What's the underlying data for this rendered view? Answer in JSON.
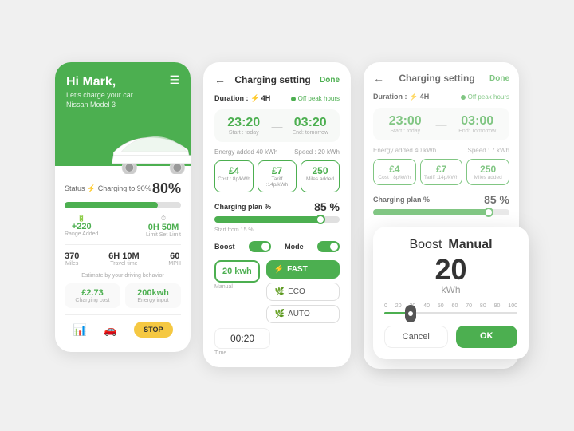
{
  "colors": {
    "green": "#4caf50",
    "yellow": "#f5c842",
    "light_bg": "#f0f0f0",
    "white": "#ffffff"
  },
  "left_card": {
    "greeting": "Hi Mark,",
    "subtext": "Let's charge your car",
    "model": "Nissan Model 3",
    "status_label": "Status ⚡ Charging to 90%",
    "status_value": "80%",
    "progress_pct": 80,
    "range_added": "+220",
    "range_label": "Range Added",
    "limit_val": "0H 50M",
    "limit_label": "Limit Set Limit",
    "miles": "370",
    "miles_label": "Miles",
    "travel": "6H 10M",
    "travel_label": "Travel time",
    "speed": "60",
    "speed_label": "MPH",
    "estimate_text": "Estimate by your driving behavior",
    "charge_cost": "£2.73",
    "charge_cost_label": "Charging cost",
    "energy_input": "200kwh",
    "energy_input_label": "Energy input",
    "stop_label": "STOP"
  },
  "mid_card": {
    "title": "Charging setting",
    "done_label": "Done",
    "duration_label": "Duration : ⚡ 4H",
    "off_peak_label": "Off peak hours",
    "start_time": "23:20",
    "start_time_label": "Start : today",
    "end_time": "03:20",
    "end_time_label": "End: tomorrow",
    "energy_label": "Energy added  40 kWh",
    "speed_label": "Speed : 20 kWh",
    "cost": "£4",
    "cost_label": "Cost : 8p/kWh",
    "tariff": "£7",
    "tariff_label": "Tariff :14p/kWh",
    "miles_added": "250",
    "miles_added_label": "Miles added",
    "plan_label": "Charging plan %",
    "plan_pct": "85 %",
    "plan_fill": 85,
    "start_from": "Start from  15 %",
    "boost_label": "Boost",
    "mode_label": "Mode",
    "kwh_value": "20 kwh",
    "kwh_label": "Manual",
    "fast_label": "FAST",
    "eco_label": "ECO",
    "auto_label": "AUTO",
    "time_value": "00:20",
    "time_label": "Time"
  },
  "right_card": {
    "title": "Charging setting",
    "done_label": "Done",
    "duration_label": "Duration : ⚡ 4H",
    "off_peak_label": "Off peak hours",
    "start_time": "23:00",
    "start_label": "Start : today",
    "end_time": "03:00",
    "end_label": "End: Tomorrow",
    "energy_label": "Energy added  40 kWh",
    "speed_label": "Speed : 7 kWh",
    "cost": "£4",
    "cost_label": "Cost : 8p/kWh",
    "tariff": "£7",
    "tariff_label": "Tariff :14p/kWh",
    "miles": "250",
    "miles_label": "Miles added",
    "plan_label": "Charging plan %",
    "plan_pct": "85 %",
    "plan_fill": 85
  },
  "modal": {
    "boost_label": "Boost",
    "manual_label": "Manual",
    "kwh_big": "20",
    "kwh_unit": "kWh",
    "range_min": "0",
    "range_markers": [
      "0",
      "20",
      "30",
      "40",
      "50",
      "60",
      "70",
      "80",
      "90",
      "100"
    ],
    "thumb_pct": 20,
    "cancel_label": "Cancel",
    "ok_label": "OK"
  }
}
